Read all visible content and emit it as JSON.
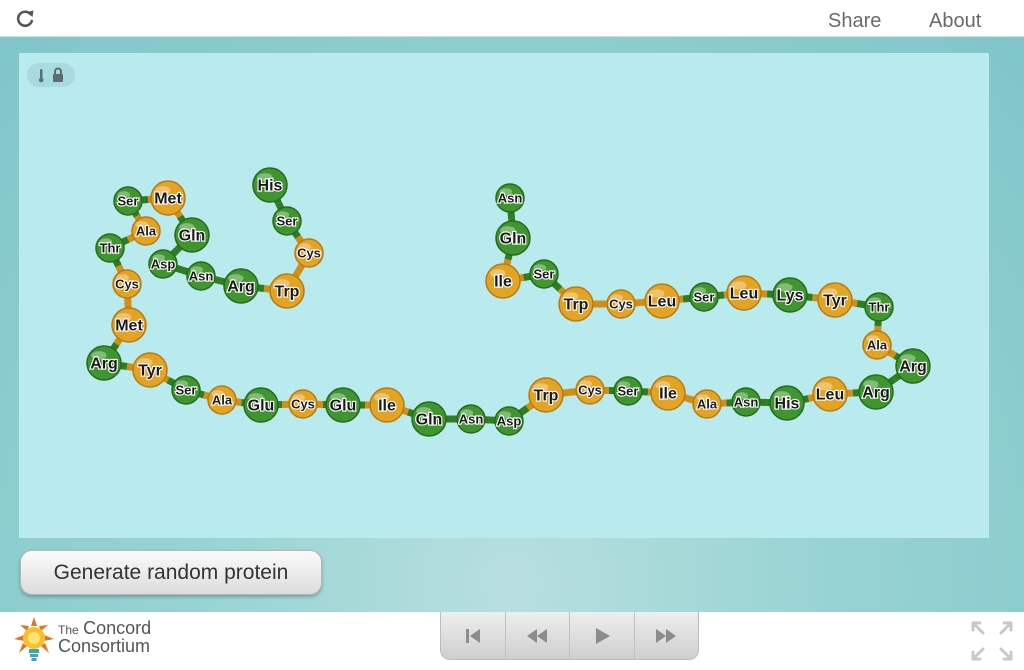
{
  "header": {
    "share_label": "Share",
    "about_label": "About"
  },
  "controls": {
    "generate_label": "Generate random protein"
  },
  "footer": {
    "logo_line1": "The",
    "logo_line2": "Concord",
    "logo_line3": "Consortium"
  },
  "colors": {
    "hydrophobic": "#e3a324",
    "hydrophilic": "#3f9530"
  },
  "protein": {
    "chain": [
      {
        "label": "His",
        "type": "g"
      },
      {
        "label": "Ser",
        "type": "g"
      },
      {
        "label": "Cys",
        "type": "o"
      },
      {
        "label": "Trp",
        "type": "o"
      },
      {
        "label": "Arg",
        "type": "g"
      },
      {
        "label": "Asn",
        "type": "g"
      },
      {
        "label": "Asp",
        "type": "g"
      },
      {
        "label": "Gln",
        "type": "g"
      },
      {
        "label": "Met",
        "type": "o"
      },
      {
        "label": "Ser",
        "type": "g"
      },
      {
        "label": "Ala",
        "type": "o"
      },
      {
        "label": "Thr",
        "type": "g"
      },
      {
        "label": "Cys",
        "type": "o"
      },
      {
        "label": "Met",
        "type": "o"
      },
      {
        "label": "Arg",
        "type": "g"
      },
      {
        "label": "Tyr",
        "type": "o"
      },
      {
        "label": "Ser",
        "type": "g"
      },
      {
        "label": "Ala",
        "type": "o"
      },
      {
        "label": "Glu",
        "type": "g"
      },
      {
        "label": "Cys",
        "type": "o"
      },
      {
        "label": "Glu",
        "type": "g"
      },
      {
        "label": "Ile",
        "type": "o"
      },
      {
        "label": "Gln",
        "type": "g"
      },
      {
        "label": "Asn",
        "type": "g"
      },
      {
        "label": "Asp",
        "type": "g"
      },
      {
        "label": "Trp",
        "type": "o"
      },
      {
        "label": "Cys",
        "type": "o"
      },
      {
        "label": "Ser",
        "type": "g"
      },
      {
        "label": "Ile",
        "type": "o"
      },
      {
        "label": "Ala",
        "type": "o"
      },
      {
        "label": "Asn",
        "type": "g"
      },
      {
        "label": "His",
        "type": "g"
      },
      {
        "label": "Leu",
        "type": "o"
      },
      {
        "label": "Arg",
        "type": "g"
      },
      {
        "label": "Arg",
        "type": "g"
      },
      {
        "label": "Ala",
        "type": "o"
      },
      {
        "label": "Thr",
        "type": "g"
      },
      {
        "label": "Tyr",
        "type": "o"
      },
      {
        "label": "Lys",
        "type": "g"
      },
      {
        "label": "Leu",
        "type": "o"
      },
      {
        "label": "Ser",
        "type": "g"
      },
      {
        "label": "Leu",
        "type": "o"
      },
      {
        "label": "Cys",
        "type": "o"
      },
      {
        "label": "Trp",
        "type": "o"
      },
      {
        "label": "Ser",
        "type": "g"
      },
      {
        "label": "Ile",
        "type": "o"
      },
      {
        "label": "Gln",
        "type": "g"
      },
      {
        "label": "Asn",
        "type": "g"
      }
    ]
  }
}
